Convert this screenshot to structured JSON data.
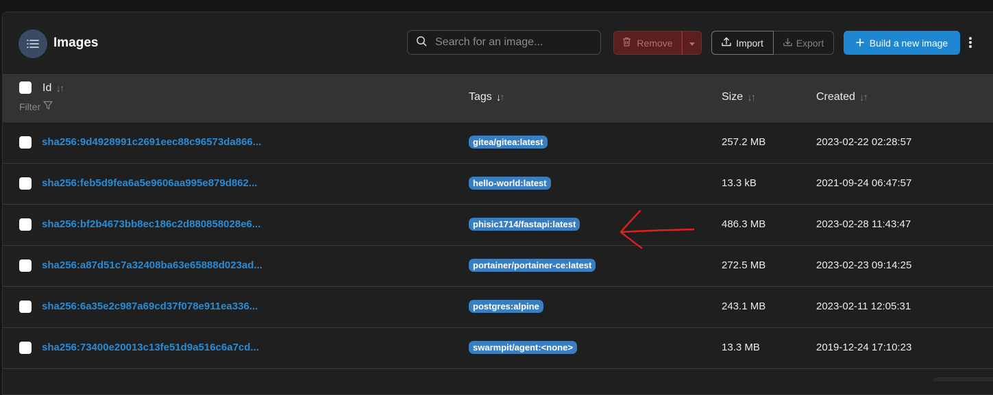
{
  "header": {
    "title": "Images",
    "search_placeholder": "Search for an image...",
    "remove_label": "Remove",
    "import_label": "Import",
    "export_label": "Export",
    "build_label": "Build a new image"
  },
  "table": {
    "columns": {
      "id": "Id",
      "filter": "Filter",
      "tags": "Tags",
      "size": "Size",
      "created": "Created"
    },
    "rows": [
      {
        "id": "sha256:9d4928991c2691eec88c96573da866...",
        "tag": "gitea/gitea:latest",
        "size": "257.2 MB",
        "created": "2023-02-22 02:28:57"
      },
      {
        "id": "sha256:feb5d9fea6a5e9606aa995e879d862...",
        "tag": "hello-world:latest",
        "size": "13.3 kB",
        "created": "2021-09-24 06:47:57"
      },
      {
        "id": "sha256:bf2b4673bb8ec186c2d880858028e6...",
        "tag": "phisic1714/fastapi:latest",
        "size": "486.3 MB",
        "created": "2023-02-28 11:43:47"
      },
      {
        "id": "sha256:a87d51c7a32408ba63e65888d023ad...",
        "tag": "portainer/portainer-ce:latest",
        "size": "272.5 MB",
        "created": "2023-02-23 09:14:25"
      },
      {
        "id": "sha256:6a35e2c987a69cd37f078e911ea336...",
        "tag": "postgres:alpine",
        "size": "243.1 MB",
        "created": "2023-02-11 12:05:31"
      },
      {
        "id": "sha256:73400e20013c13fe51d9a516c6a7cd...",
        "tag": "swarmpit/agent:<none>",
        "size": "13.3 MB",
        "created": "2019-12-24 17:10:23"
      }
    ]
  },
  "colors": {
    "accent": "#1f87d2",
    "link": "#2a8bd4",
    "tag_badge": "#3b7ebf",
    "danger": "#5c1e1e",
    "annotation_arrow": "#e0201e"
  }
}
